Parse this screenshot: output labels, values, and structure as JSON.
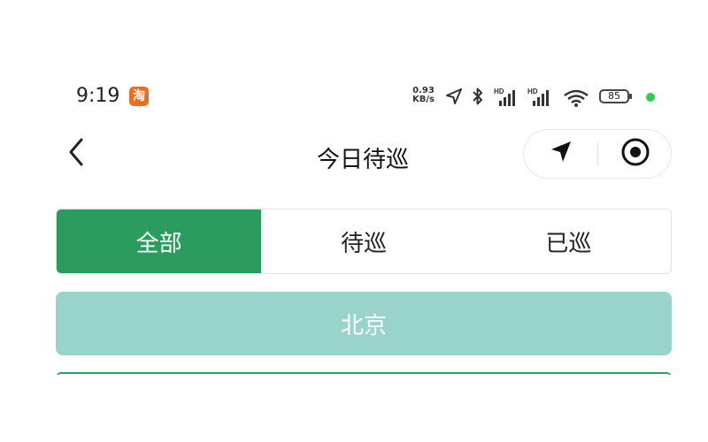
{
  "status_bar": {
    "time": "9:19",
    "app_badge": "淘",
    "net_speed_value": "0.93",
    "net_speed_unit": "KB/s",
    "signal_tag_1": "HD",
    "signal_tag_2": "HD",
    "battery": "85",
    "icons": [
      "location-arrow-icon",
      "bluetooth-icon",
      "signal-icon",
      "signal-icon",
      "wifi-icon",
      "battery-icon"
    ],
    "dot_color": "#2ecc52"
  },
  "nav": {
    "title": "今日待巡",
    "back_icon": "chevron-left-icon",
    "capsule_icons": [
      "navigate-arrow-icon",
      "target-circle-icon"
    ]
  },
  "tabs": [
    {
      "label": "全部",
      "active": true
    },
    {
      "label": "待巡",
      "active": false
    },
    {
      "label": "已巡",
      "active": false
    }
  ],
  "region": {
    "label": "北京"
  },
  "colors": {
    "accent": "#2b9c5d",
    "region_bg": "#99d4cb",
    "background": "#ffffff"
  }
}
